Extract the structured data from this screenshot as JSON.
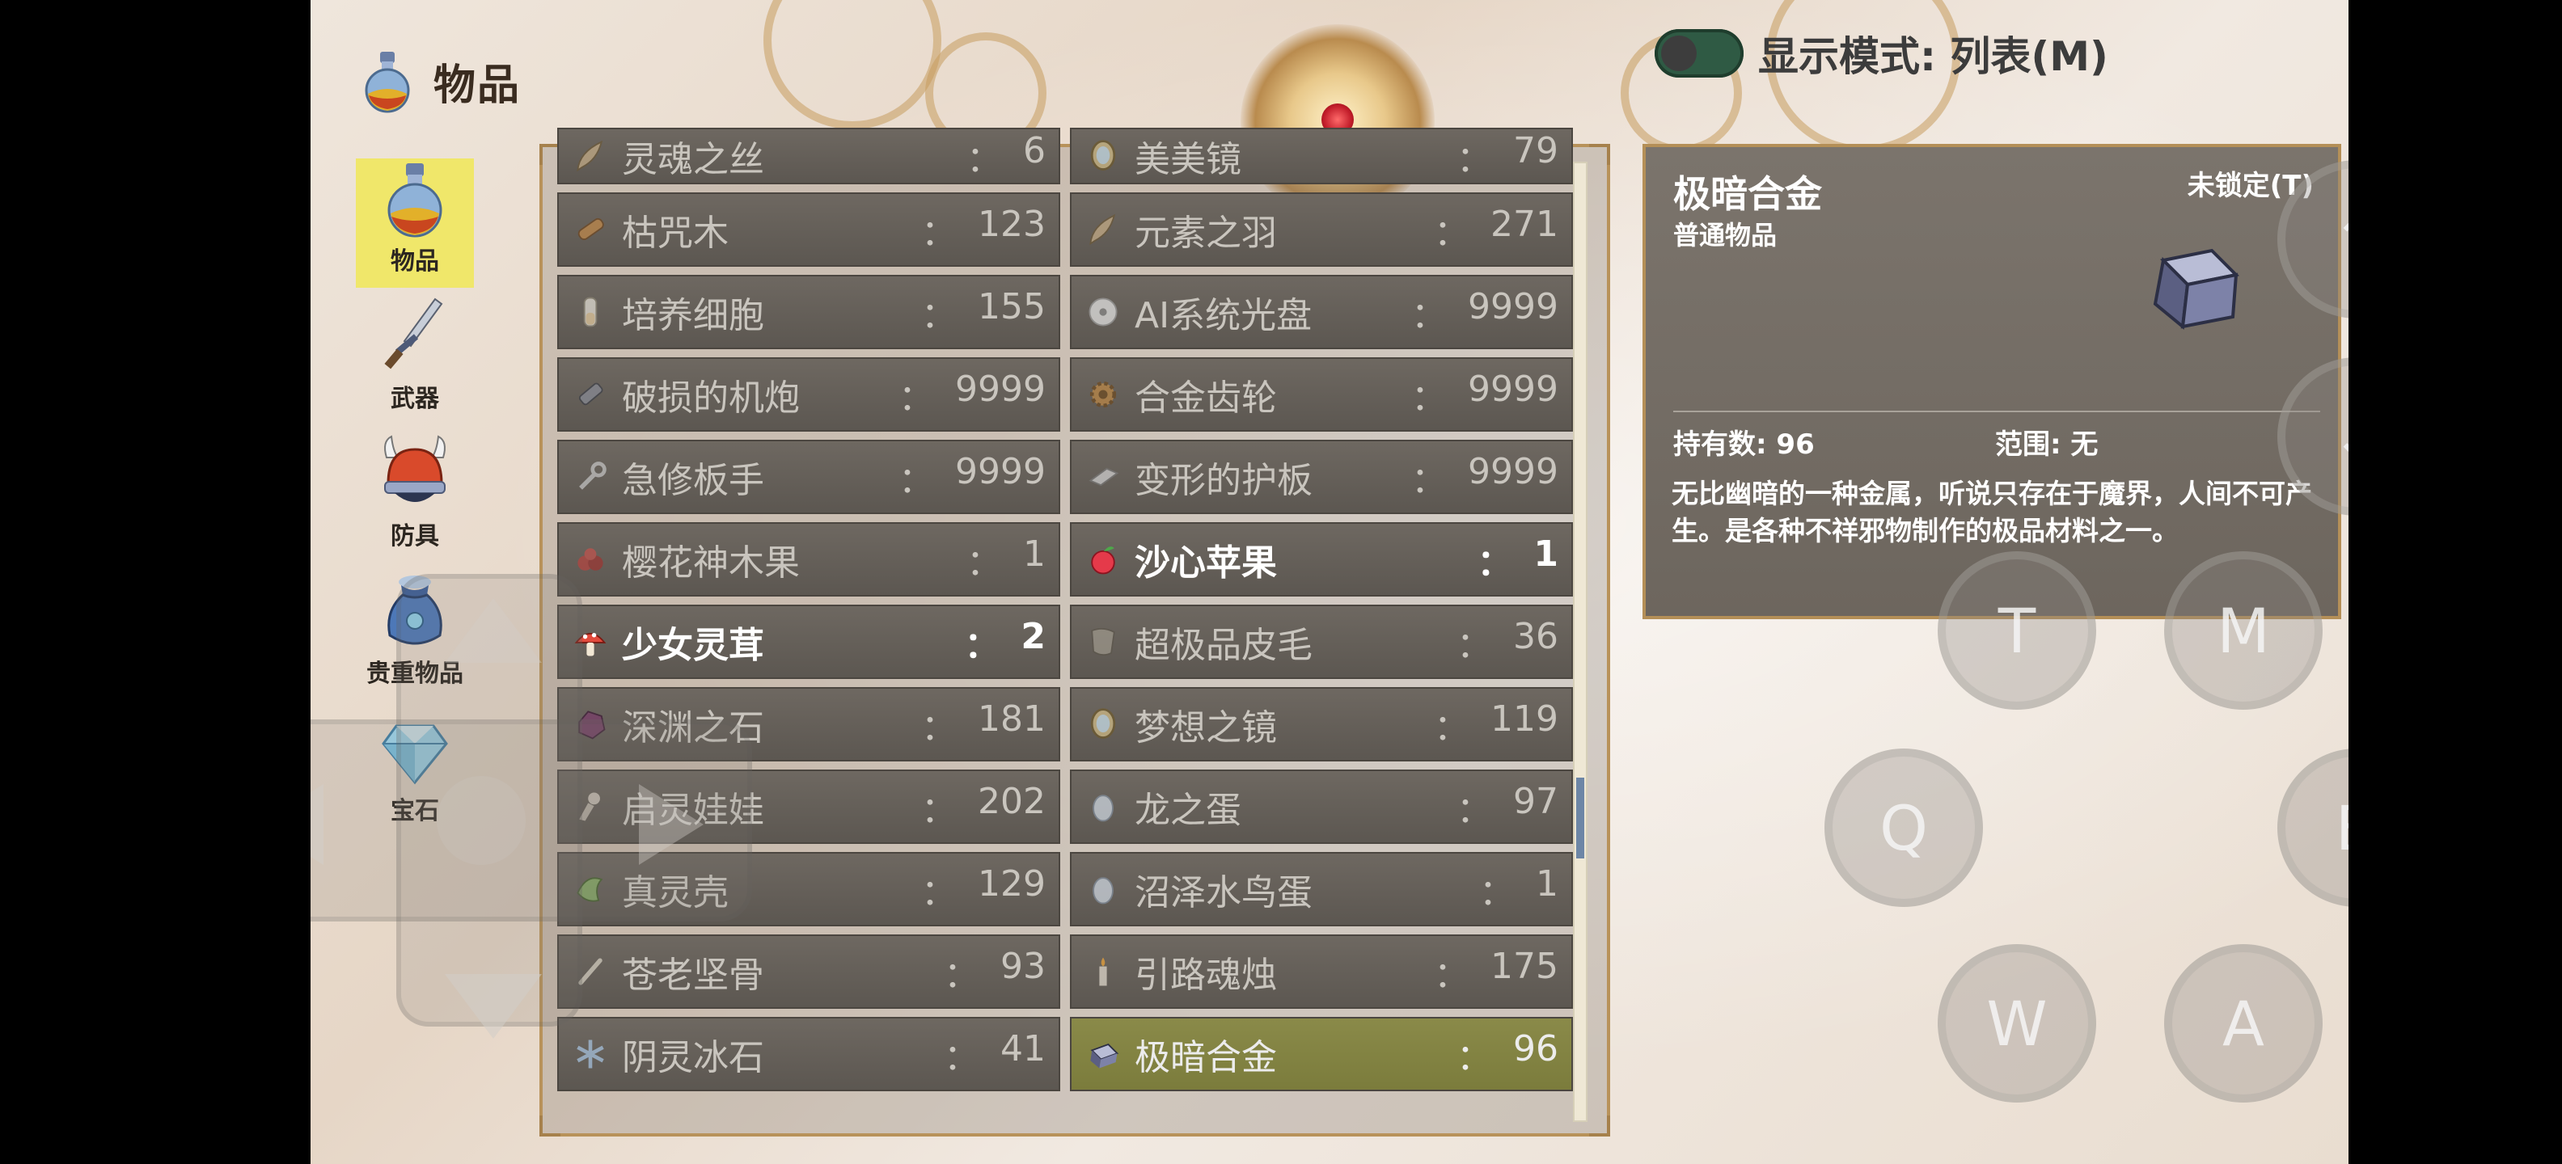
{
  "header": {
    "title": "物品",
    "icon": "potion-icon"
  },
  "display_mode": {
    "label": "显示模式: 列表(M)",
    "toggle_on": true
  },
  "categories": [
    {
      "label": "物品",
      "icon": "potion-icon",
      "active": true
    },
    {
      "label": "武器",
      "icon": "sword-icon",
      "active": false
    },
    {
      "label": "防具",
      "icon": "helmet-icon",
      "active": false
    },
    {
      "label": "贵重物品",
      "icon": "bag-icon",
      "active": false
    },
    {
      "label": "宝石",
      "icon": "gem-icon",
      "active": false
    }
  ],
  "items": [
    {
      "name": "灵魂之丝",
      "qty": "6",
      "icon": "feather-icon",
      "partial": true
    },
    {
      "name": "美美镜",
      "qty": "79",
      "icon": "mirror-icon",
      "partial": true
    },
    {
      "name": "枯咒木",
      "qty": "123",
      "icon": "wood-icon"
    },
    {
      "name": "元素之羽",
      "qty": "271",
      "icon": "feather-icon"
    },
    {
      "name": "培养细胞",
      "qty": "155",
      "icon": "vial-icon"
    },
    {
      "name": "AI系统光盘",
      "qty": "9999",
      "icon": "disc-icon"
    },
    {
      "name": "破损的机炮",
      "qty": "9999",
      "icon": "cannon-icon"
    },
    {
      "name": "合金齿轮",
      "qty": "9999",
      "icon": "gear-icon"
    },
    {
      "name": "急修板手",
      "qty": "9999",
      "icon": "wrench-icon"
    },
    {
      "name": "变形的护板",
      "qty": "9999",
      "icon": "plate-icon"
    },
    {
      "name": "樱花神木果",
      "qty": "1",
      "icon": "berry-icon"
    },
    {
      "name": "沙心苹果",
      "qty": "1",
      "icon": "apple-icon",
      "highlight": true
    },
    {
      "name": "少女灵茸",
      "qty": "2",
      "icon": "mushroom-icon",
      "highlight": true
    },
    {
      "name": "超极品皮毛",
      "qty": "36",
      "icon": "fur-icon"
    },
    {
      "name": "深渊之石",
      "qty": "181",
      "icon": "stone-icon"
    },
    {
      "name": "梦想之镜",
      "qty": "119",
      "icon": "mirror-icon"
    },
    {
      "name": "启灵娃娃",
      "qty": "202",
      "icon": "doll-icon"
    },
    {
      "name": "龙之蛋",
      "qty": "97",
      "icon": "egg-icon"
    },
    {
      "name": "真灵壳",
      "qty": "129",
      "icon": "shell-icon"
    },
    {
      "name": "沼泽水鸟蛋",
      "qty": "1",
      "icon": "egg-icon"
    },
    {
      "name": "苍老坚骨",
      "qty": "93",
      "icon": "bone-icon"
    },
    {
      "name": "引路魂烛",
      "qty": "175",
      "icon": "candle-icon"
    },
    {
      "name": "阴灵冰石",
      "qty": "41",
      "icon": "ice-icon"
    },
    {
      "name": "极暗合金",
      "qty": "96",
      "icon": "ingot-icon",
      "selected": true
    }
  ],
  "detail": {
    "name": "极暗合金",
    "lock": "未锁定(T)",
    "type": "普通物品",
    "held": "持有数: 96",
    "range": "范围: 无",
    "description": "无比幽暗的一种金属，听说只存在于魔界，人间不可产生。是各种不祥邪物制作的极品材料之一。"
  },
  "controls": {
    "up": "↑",
    "down": "↓",
    "t": "T",
    "m": "M",
    "q": "Q",
    "b": "B",
    "w": "W",
    "a": "A"
  },
  "colors": {
    "selected_row": "#7b7c3c",
    "active_category": "#f0e76a",
    "toggle": "#2f5a44"
  }
}
